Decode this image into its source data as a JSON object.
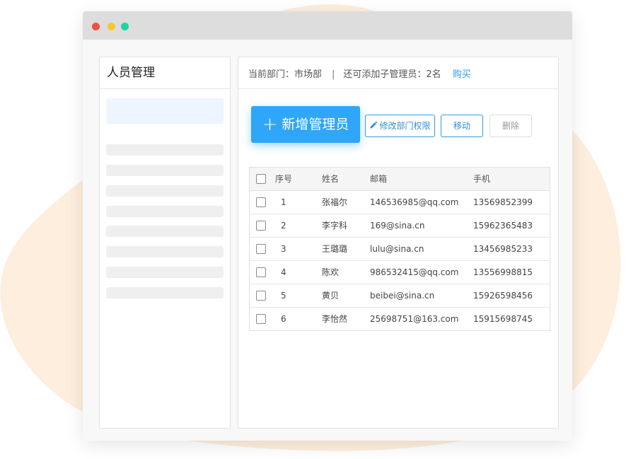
{
  "window": {
    "traffic_lights": {
      "red": "#ee4f45",
      "yellow": "#f4c92c",
      "green": "#1fd3a1"
    }
  },
  "sidebar": {
    "title": "人员管理"
  },
  "header": {
    "department_label": "当前部门：市场部",
    "separator": "|",
    "remaining_label": "还可添加子管理员：2名",
    "buy_link": "购买"
  },
  "toolbar": {
    "add_plus": "+",
    "add_label": "新增管理员",
    "edit_label": "修改部门权限",
    "move_label": "移动",
    "delete_label": "删除"
  },
  "table": {
    "columns": {
      "index": "序号",
      "name": "姓名",
      "email": "邮箱",
      "phone": "手机"
    },
    "rows": [
      {
        "index": "1",
        "name": "张福尔",
        "email": "146536985@qq.com",
        "phone": "13569852399"
      },
      {
        "index": "2",
        "name": "李字科",
        "email": "169@sina.cn",
        "phone": "15962365483"
      },
      {
        "index": "3",
        "name": "王璐璐",
        "email": "lulu@sina.cn",
        "phone": "13456985233"
      },
      {
        "index": "4",
        "name": "陈欢",
        "email": "986532415@qq.com",
        "phone": "13556998815"
      },
      {
        "index": "5",
        "name": "黄贝",
        "email": "beibei@sina.cn",
        "phone": "15926598456"
      },
      {
        "index": "6",
        "name": "李怡然",
        "email": "25698751@163.com",
        "phone": "15915698745"
      }
    ]
  },
  "colors": {
    "accent": "#2fa6f8",
    "link": "#2f9cf1",
    "background_blob": "#fdeedd"
  }
}
